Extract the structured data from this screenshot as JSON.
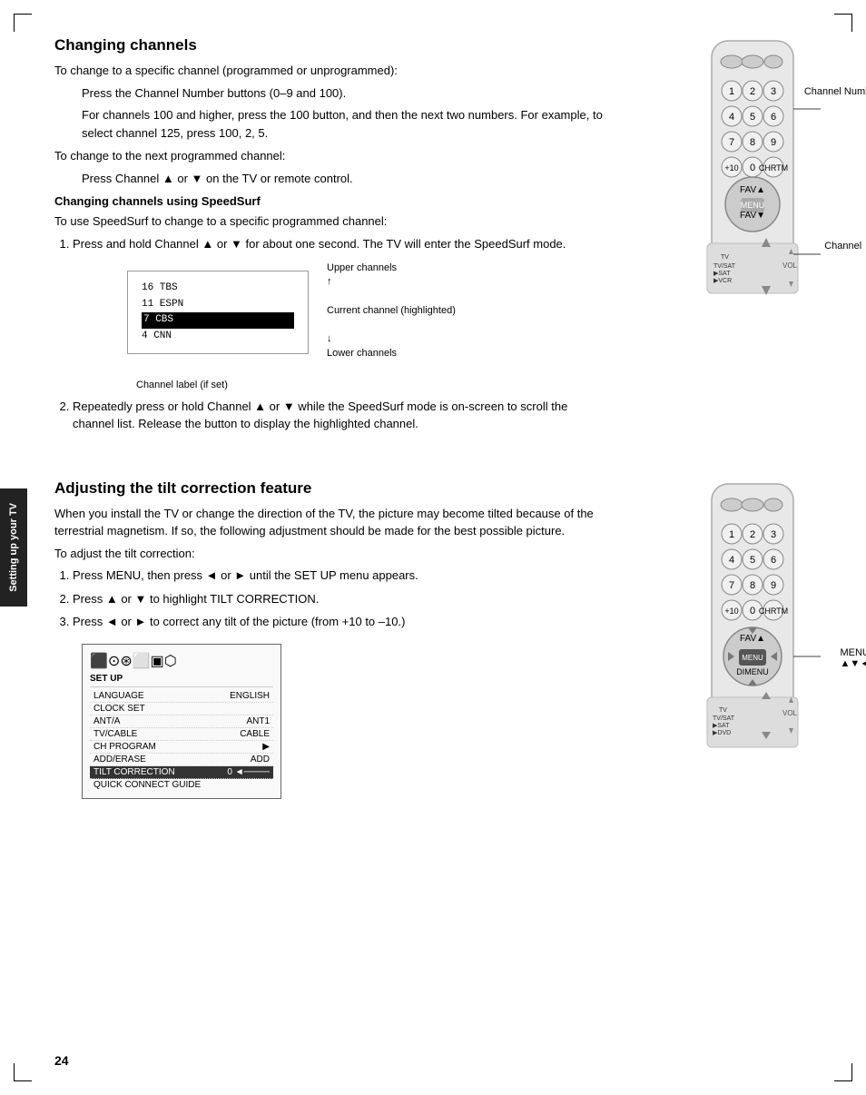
{
  "page": {
    "number": "24",
    "corner_marks": true
  },
  "side_tab": {
    "text": "Setting up\nyour TV"
  },
  "section1": {
    "heading": "Changing channels",
    "para1": "To change to a specific channel (programmed or unprogrammed):",
    "bullet1": "Press the Channel Number buttons (0–9 and 100).",
    "bullet2": "For channels 100 and higher, press the 100 button, and then the next two numbers. For example, to select channel 125, press 100, 2, 5.",
    "para2": "To change to the next programmed channel:",
    "bullet3": "Press Channel ▲ or ▼ on the TV or remote control.",
    "subheading": "Changing channels using SpeedSurf",
    "speedsurf_intro": "To use SpeedSurf to change to a specific programmed channel:",
    "step1": "Press and hold Channel ▲ or ▼ for about one second. The TV will enter the SpeedSurf mode.",
    "step2": "Repeatedly press or hold Channel ▲ or ▼ while the SpeedSurf mode is on-screen to scroll the channel list. Release the button to display the highlighted channel.",
    "diagram": {
      "channels": [
        "16  TBS",
        "11  ESPN",
        "7   CBS",
        "4   CNN"
      ],
      "label": "Channel label (if set)"
    },
    "annotations": {
      "upper": "Upper channels",
      "upper_arrow": "↑",
      "current": "Current channel (highlighted)",
      "lower_arrow": "↓",
      "lower": "Lower channels"
    },
    "remote_labels": {
      "channel_number": "Channel\nNumber",
      "channel_updown": "Channel ▲▼"
    }
  },
  "section2": {
    "heading": "Adjusting the tilt correction feature",
    "intro1": "When you install the TV or change the direction of the TV, the picture may become tilted because of the terrestrial magnetism. If so, the following adjustment should be made for the best possible picture.",
    "intro2": "To adjust the tilt correction:",
    "step1": "Press MENU, then press ◄ or ► until the SET UP menu appears.",
    "step2": "Press ▲ or ▼ to highlight TILT CORRECTION.",
    "step3": "Press ◄ or ► to correct any tilt of the picture (from +10 to –10.)",
    "menu": {
      "title": "SET UP",
      "rows": [
        {
          "label": "LANGUAGE",
          "value": "ENGLISH",
          "highlighted": false
        },
        {
          "label": "CLOCK SET",
          "value": "",
          "highlighted": false
        },
        {
          "label": "ANT/A",
          "value": "ANT1",
          "highlighted": false
        },
        {
          "label": "TV/CABLE",
          "value": "CABLE",
          "highlighted": false
        },
        {
          "label": "CH PROGRAM",
          "value": "▶",
          "highlighted": false
        },
        {
          "label": "ADD/ERASE",
          "value": "ADD",
          "highlighted": false
        },
        {
          "label": "TILT CORRECTION",
          "value": "0 ◄————",
          "highlighted": true
        },
        {
          "label": "QUICK CONNECT GUIDE",
          "value": "",
          "highlighted": false
        }
      ]
    },
    "remote_labels": {
      "menu": "MENU",
      "buttons": "▲▼◄►"
    }
  }
}
